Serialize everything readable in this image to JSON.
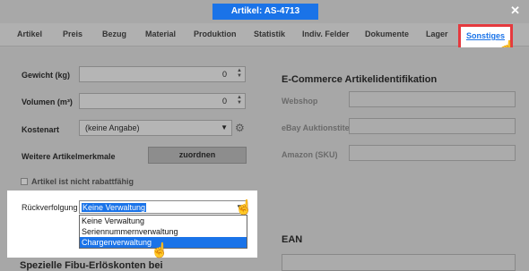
{
  "window": {
    "title": "Artikel: AS-4713",
    "close_icon": "close-icon"
  },
  "tabs": [
    "Artikel",
    "Preis",
    "Bezug",
    "Material",
    "Produktion",
    "Statistik",
    "Indiv. Felder",
    "Dokumente",
    "Lager"
  ],
  "active_tab": "Sonstiges",
  "left": {
    "gewicht_label": "Gewicht (kg)",
    "gewicht_value": "0",
    "volumen_label": "Volumen (m³)",
    "volumen_value": "0",
    "kostenart_label": "Kostenart",
    "kostenart_value": "(keine Angabe)",
    "merkmale_label": "Weitere Artikelmerkmale",
    "zuordnen_button": "zuordnen",
    "rabatt_label": "Artikel ist nicht rabattfähig",
    "rueckverfolgung_label": "Rückverfolgung",
    "rueckverfolgung_value": "Keine Verwaltung",
    "options": [
      "Keine Verwaltung",
      "Seriennummernverwaltung",
      "Chargenverwaltung"
    ],
    "selected_option_index": 2,
    "fibu_title": "Spezielle Fibu-Erlöskonten bei"
  },
  "right": {
    "ecommerce_title": "E-Commerce Artikelidentifikation",
    "webshop_label": "Webshop",
    "ebay_label": "eBay Auktionstitel",
    "amazon_label": "Amazon (SKU)",
    "ean_title": "EAN"
  },
  "colors": {
    "accent": "#1a73e8",
    "highlight_border": "#e5393e"
  }
}
